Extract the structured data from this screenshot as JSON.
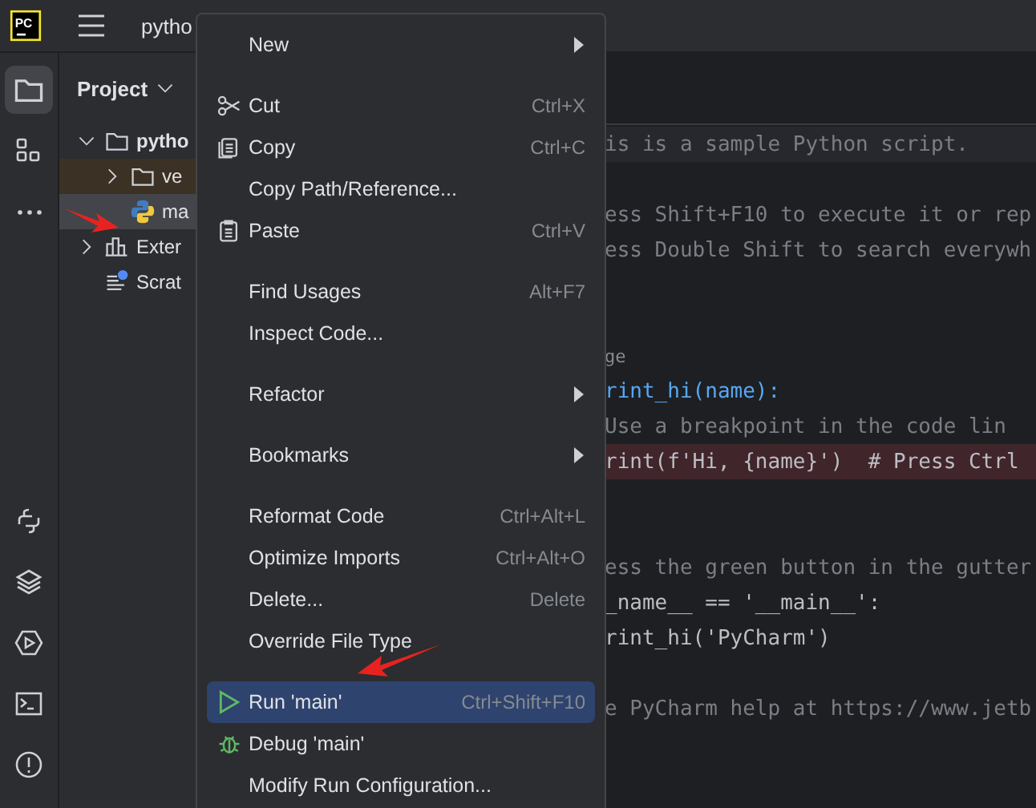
{
  "title_bar": {
    "logo": "PC",
    "project": "pytho"
  },
  "toolbar": [
    {
      "selected": true
    },
    {
      "selected": false
    }
  ],
  "project_panel": {
    "title": "Project",
    "tree": [
      {
        "label": "pytho",
        "expanded": true,
        "selected": false,
        "kind": "folder",
        "children": [
          {
            "label": "ve",
            "expanded": false,
            "selected": false,
            "kind": "excluded"
          },
          {
            "label": "ma",
            "selected": true,
            "kind": "python"
          }
        ]
      },
      {
        "label": "Exter",
        "expanded": false,
        "selected": false,
        "kind": "library"
      },
      {
        "label": "Scrat",
        "selected": false,
        "kind": "scratch"
      }
    ]
  },
  "editor": {
    "lines": [
      {
        "text": "is is a sample Python script.",
        "kind": "comment",
        "current": true
      },
      {
        "kind": "blank",
        "current": false
      },
      {
        "text": "ess Shift+F10 to execute it or rep",
        "kind": "comment",
        "current": false
      },
      {
        "text": "ess Double Shift to search everywh",
        "kind": "comment",
        "current": false
      },
      {
        "kind": "blank",
        "current": false
      },
      {
        "kind": "blank",
        "current": false
      },
      {
        "text": "ge",
        "kind": "hint",
        "current": false
      },
      {
        "text": "rint_hi(name):",
        "kind": "def",
        "current": false
      },
      {
        "text": "Use a breakpoint in the code lin",
        "kind": "comment",
        "current": false
      },
      {
        "text": "rint(f'Hi, {name}')  # Press Ctrl",
        "kind": "breakpoint",
        "current": false
      },
      {
        "kind": "blank",
        "current": false
      },
      {
        "kind": "blank",
        "current": false
      },
      {
        "text": "ess the green button in the gutter",
        "kind": "comment",
        "current": false
      },
      {
        "text": "_name__ == '__main__':",
        "kind": "code",
        "current": false
      },
      {
        "text": "rint_hi('PyCharm')",
        "kind": "code",
        "current": false
      },
      {
        "kind": "blank",
        "current": false
      },
      {
        "text": "e PyCharm help at https://www.jetb",
        "kind": "comment",
        "current": false
      }
    ]
  },
  "context_menu": {
    "groups": [
      {
        "items": [
          {
            "label": "New",
            "kind": "submenu",
            "selected": false
          }
        ]
      },
      {
        "items": [
          {
            "label": "Cut",
            "shortcut": "Ctrl+X",
            "kind": "item",
            "selected": false
          },
          {
            "label": "Copy",
            "shortcut": "Ctrl+C",
            "kind": "item",
            "selected": false
          },
          {
            "label": "Copy Path/Reference...",
            "kind": "item",
            "selected": false
          },
          {
            "label": "Paste",
            "shortcut": "Ctrl+V",
            "kind": "item",
            "selected": false
          }
        ]
      },
      {
        "items": [
          {
            "label": "Find Usages",
            "shortcut": "Alt+F7",
            "kind": "item",
            "selected": false
          },
          {
            "label": "Inspect Code...",
            "kind": "item",
            "selected": false
          }
        ]
      },
      {
        "items": [
          {
            "label": "Refactor",
            "kind": "submenu",
            "selected": false
          }
        ]
      },
      {
        "items": [
          {
            "label": "Bookmarks",
            "kind": "submenu",
            "selected": false
          }
        ]
      },
      {
        "items": [
          {
            "label": "Reformat Code",
            "shortcut": "Ctrl+Alt+L",
            "kind": "item",
            "selected": false
          },
          {
            "label": "Optimize Imports",
            "shortcut": "Ctrl+Alt+O",
            "kind": "item",
            "selected": false
          },
          {
            "label": "Delete...",
            "shortcut": "Delete",
            "kind": "item",
            "selected": false
          },
          {
            "label": "Override File Type",
            "kind": "item",
            "selected": false
          }
        ]
      },
      {
        "items": [
          {
            "label": "Run 'main'",
            "shortcut": "Ctrl+Shift+F10",
            "kind": "item",
            "selected": true
          },
          {
            "label": "Debug 'main'",
            "kind": "item",
            "selected": false
          },
          {
            "label": "Modify Run Configuration...",
            "kind": "item",
            "selected": false
          }
        ]
      }
    ]
  }
}
